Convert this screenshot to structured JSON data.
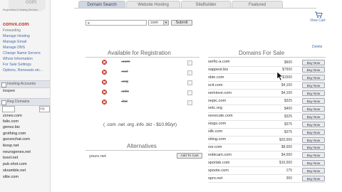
{
  "logo": {
    "com": "com",
    "tagline": "Registration & Hosting Services"
  },
  "sidebar": {
    "brand": "convx.com",
    "section_label": "Forwarding",
    "links": [
      "Manage Hosting",
      "Manage Email",
      "Manage DNS",
      "Change Name Servers",
      "Whois Information",
      "For Sale Settings",
      "Options, Renewals etc..."
    ],
    "panel1": {
      "label": "Hosting Accounts",
      "value": "itsspee"
    },
    "panel2": {
      "label": "Reg Domains",
      "tld_select": "org"
    },
    "domains": [
      "zxnes.com",
      "falix.com",
      "genez.biz",
      "grothing.com",
      "gunzochat.com",
      "ikosp.net",
      "neurogenes.net",
      "toxel.net",
      "puk-shot.com",
      "skramble.net",
      "xlite.com"
    ]
  },
  "tabs": [
    "Domain Search",
    "Website Hosting",
    "SiteBuilder",
    "Featured"
  ],
  "active_tab": 0,
  "search": {
    "value": "x",
    "tld": ".com",
    "submit_label": "Submit"
  },
  "cart": {
    "label": "View Cart",
    "icon": "cart-icon"
  },
  "delete_label": "Delete",
  "availability": {
    "title": "Available for Registration",
    "items": [
      ".com",
      ".net",
      ".org",
      ".info",
      ".biz"
    ],
    "status_icon": "unavailable-x-icon",
    "status_color": "#c0392b",
    "price_note": "( .com .net .org .info .biz - $10.95/yr)"
  },
  "alternatives": {
    "title": "Alternatives",
    "domain": "yours.net",
    "add_label": "Add To Cart"
  },
  "for_sale": {
    "title": "Domains For Sale",
    "buy_label": "Buy Now",
    "items": [
      {
        "domain": "xerfic-a.com",
        "price": "$600"
      },
      {
        "domain": "xappest.biz",
        "price": "$7500"
      },
      {
        "domain": "xbie.com",
        "price": "$1500"
      },
      {
        "domain": "xcit.com",
        "price": "$4,100"
      },
      {
        "domain": "xemiove.com",
        "price": "$4,100"
      },
      {
        "domain": "xepic.com",
        "price": "$325"
      },
      {
        "domain": "xetc.org",
        "price": "$400"
      },
      {
        "domain": "xexecute.com",
        "price": "$325"
      },
      {
        "domain": "xiogs.com",
        "price": "$375"
      },
      {
        "domain": "xilk.com",
        "price": "$375"
      },
      {
        "domain": "xiting.com",
        "price": "$20,000"
      },
      {
        "domain": "xor.com",
        "price": "$8,000"
      },
      {
        "domain": "xobicam.com",
        "price": "$4,000"
      },
      {
        "domain": "xportak.com",
        "price": "$10,000"
      },
      {
        "domain": "xpoote.com",
        "price": "175"
      },
      {
        "domain": "xpro.net",
        "price": "350"
      }
    ]
  }
}
